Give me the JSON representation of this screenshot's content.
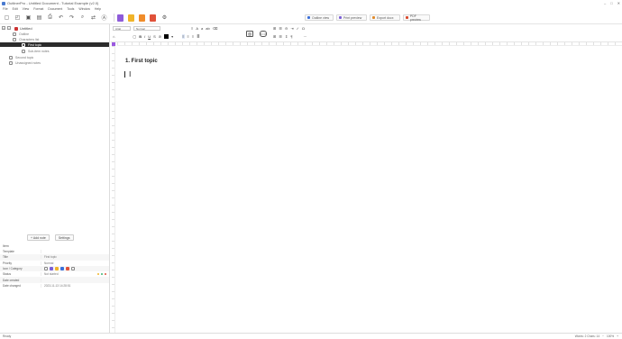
{
  "window": {
    "title": "OutlinerPro - Untitled Document - Tutorial Example (v2.0)"
  },
  "menu": [
    "File",
    "Edit",
    "View",
    "Format",
    "Document",
    "Tools",
    "Window",
    "Help"
  ],
  "toolbar": {
    "tabs": [
      {
        "label": "Outline view",
        "color": "#3a6fd8"
      },
      {
        "label": "Print preview",
        "color": "#7b5fd6"
      },
      {
        "label": "Export docx",
        "color": "#e08a2a"
      },
      {
        "label": "PDF preview",
        "color": "#d9482b"
      }
    ],
    "export_colors": [
      "#8e5bd9",
      "#f0b429",
      "#f08c2a",
      "#e0523a"
    ]
  },
  "tree": {
    "root": "Untitled",
    "items": [
      {
        "label": "Outline",
        "indent": 1
      },
      {
        "label": "Characters list",
        "indent": 1
      },
      {
        "label": "First topic",
        "indent": 1,
        "selected": true
      },
      {
        "label": "Sub-item notes",
        "indent": 2
      },
      {
        "label": "Second topic",
        "indent": 1
      },
      {
        "label": "Unassigned notes",
        "indent": 1
      }
    ],
    "add_button": "+ Add note",
    "settings_button": "Settings"
  },
  "properties": {
    "header": "Item",
    "rows": [
      {
        "key": "Template",
        "value": ""
      },
      {
        "key": "Title",
        "value": "First topic"
      },
      {
        "key": "Priority",
        "value": "Normal"
      },
      {
        "key": "Icon / Category",
        "value": ""
      },
      {
        "key": "Status",
        "value": "Not started"
      },
      {
        "key": "Date created",
        "value": ""
      },
      {
        "key": "Date changed",
        "value": "2023-11-13 14:28:51"
      }
    ]
  },
  "editor": {
    "font": "Arial",
    "size": "Normal",
    "heading": "1. First topic"
  },
  "status": {
    "left": "Ready",
    "zoom": "100%",
    "info": "Words: 2  Chars: 14"
  }
}
